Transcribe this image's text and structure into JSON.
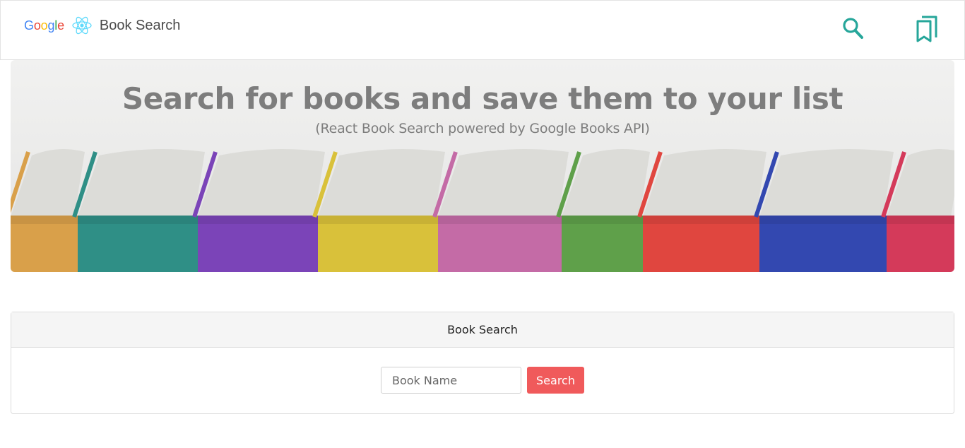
{
  "navbar": {
    "logo_text": "Google",
    "title": "Book Search",
    "icons": [
      "google-logo",
      "react-icon",
      "search-icon",
      "bookmarks-icon"
    ],
    "accent_color": "#26a69a"
  },
  "hero": {
    "title": "Search for books and save them to your list",
    "subtitle": "(React Book Search powered by Google Books API)",
    "spine_colors": [
      "#d9a04a",
      "#2f8f86",
      "#7b44b8",
      "#d9c13a",
      "#c46ba6",
      "#5fa04a",
      "#e0463f",
      "#3348b0",
      "#d43a5a"
    ]
  },
  "search_card": {
    "header": "Book Search",
    "input_placeholder": "Book Name",
    "input_value": "",
    "button_label": "Search",
    "button_color": "#f05a5b"
  }
}
